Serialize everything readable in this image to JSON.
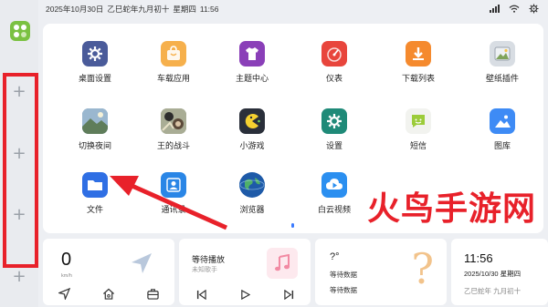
{
  "status": {
    "date": "2025年10月30日",
    "lunar": "乙巳蛇年九月初十",
    "weekday": "星期四",
    "time": "11:56"
  },
  "dock": {
    "app_icon": "launcher-icon",
    "add_buttons": [
      "+",
      "+",
      "+",
      "+"
    ]
  },
  "apps": [
    {
      "label": "桌面设置",
      "icon": "gear-icon",
      "color": "#4a5b9a"
    },
    {
      "label": "车载应用",
      "icon": "shopping-bag-icon",
      "color": "#f6b04c"
    },
    {
      "label": "主题中心",
      "icon": "tshirt-icon",
      "color": "#8a3fb8"
    },
    {
      "label": "仪表",
      "icon": "gauge-icon",
      "color": "#e8453c"
    },
    {
      "label": "下载列表",
      "icon": "download-icon",
      "color": "#f58a2e"
    },
    {
      "label": "壁纸插件",
      "icon": "image-icon",
      "color": "#d8dde3"
    },
    {
      "label": "切换夜间",
      "icon": "landscape-icon",
      "color": "#6d8fae"
    },
    {
      "label": "王的战斗",
      "icon": "game-art-icon",
      "color": "#8a8f7a"
    },
    {
      "label": "小游戏",
      "icon": "pacman-icon",
      "color": "#2a2f3a"
    },
    {
      "label": "设置",
      "icon": "gear-icon",
      "color": "#1f8a78"
    },
    {
      "label": "短信",
      "icon": "message-icon",
      "color": "#f2f3ef"
    },
    {
      "label": "图库",
      "icon": "gallery-icon",
      "color": "#3e8bf5"
    },
    {
      "label": "文件",
      "icon": "folder-icon",
      "color": "#2f6fe4"
    },
    {
      "label": "通讯录",
      "icon": "contacts-icon",
      "color": "#2a86e6"
    },
    {
      "label": "浏览器",
      "icon": "globe-icon",
      "color": "#1e5aa8"
    },
    {
      "label": "白云视频",
      "icon": "play-cloud-icon",
      "color": "#2b8ff0"
    }
  ],
  "speed_card": {
    "speed": "0",
    "unit": "km/h",
    "buttons": [
      "navigation-icon",
      "home-icon",
      "briefcase-icon"
    ]
  },
  "music_card": {
    "title": "等待播放",
    "artist": "未知歌手",
    "cover_icon": "music-note-icon",
    "controls": [
      "previous-icon",
      "play-icon",
      "next-icon"
    ]
  },
  "weather_card": {
    "temp": "?°",
    "line1": "等待数据",
    "line2": "等待数据",
    "icon": "question-icon"
  },
  "clock_card": {
    "time": "11:56",
    "date": "2025/10/30 星期四",
    "lunar": "乙巳蛇年 九月初十"
  },
  "watermark": "火鸟手游网",
  "colors": {
    "annotation_red": "#e8212a",
    "accent_blue": "#3b7bff"
  }
}
